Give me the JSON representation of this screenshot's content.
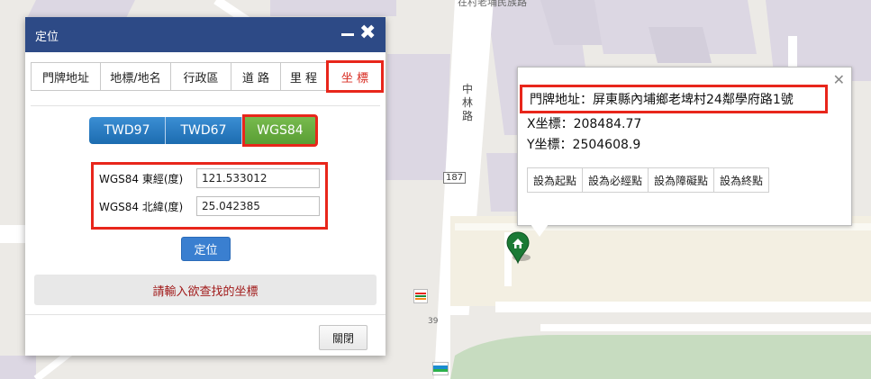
{
  "map": {
    "top_street": "在村老埔民族路",
    "road_name_vertical": "中林路",
    "route_shield": "187",
    "road_number": "39",
    "colors": {
      "land": "#eceae6",
      "block": "#dcd7e3",
      "road": "#ffffff",
      "sand": "#f3efe2",
      "park": "#c7dcc0"
    }
  },
  "dialog": {
    "title": "定位",
    "minimize_icon": "minimize-icon",
    "close_icon": "close-icon",
    "tabs": [
      {
        "label": "門牌地址",
        "active": false
      },
      {
        "label": "地標/地名",
        "active": false
      },
      {
        "label": "行政區",
        "active": false
      },
      {
        "label": "道 路",
        "active": false
      },
      {
        "label": "里 程",
        "active": false
      },
      {
        "label": "坐 標",
        "active": true
      }
    ],
    "systems": [
      {
        "label": "TWD97",
        "active": false
      },
      {
        "label": "TWD67",
        "active": false
      },
      {
        "label": "WGS84",
        "active": true
      }
    ],
    "longitude": {
      "label": "WGS84 東經(度)",
      "value": "121.533012"
    },
    "latitude": {
      "label": "WGS84 北緯(度)",
      "value": "25.042385"
    },
    "locate_button": "定位",
    "message": "請輸入欲查找的坐標",
    "close_button": "關閉",
    "colors": {
      "header": "#2d4a86",
      "highlight": "#e8261b",
      "active_system": "#6aad41",
      "system": "#2a7cc2"
    }
  },
  "popup": {
    "address": "門牌地址：屏東縣內埔鄉老埤村24鄰學府路1號",
    "x": "X坐標：208484.77",
    "y": "Y坐標：2504608.9",
    "actions": [
      "設為起點",
      "設為必經點",
      "設為障礙點",
      "設為終點"
    ],
    "close_icon": "close-icon"
  },
  "markers": {
    "house": "house-marker-icon",
    "store_711": "7-eleven-icon",
    "familymart": "familymart-icon"
  }
}
